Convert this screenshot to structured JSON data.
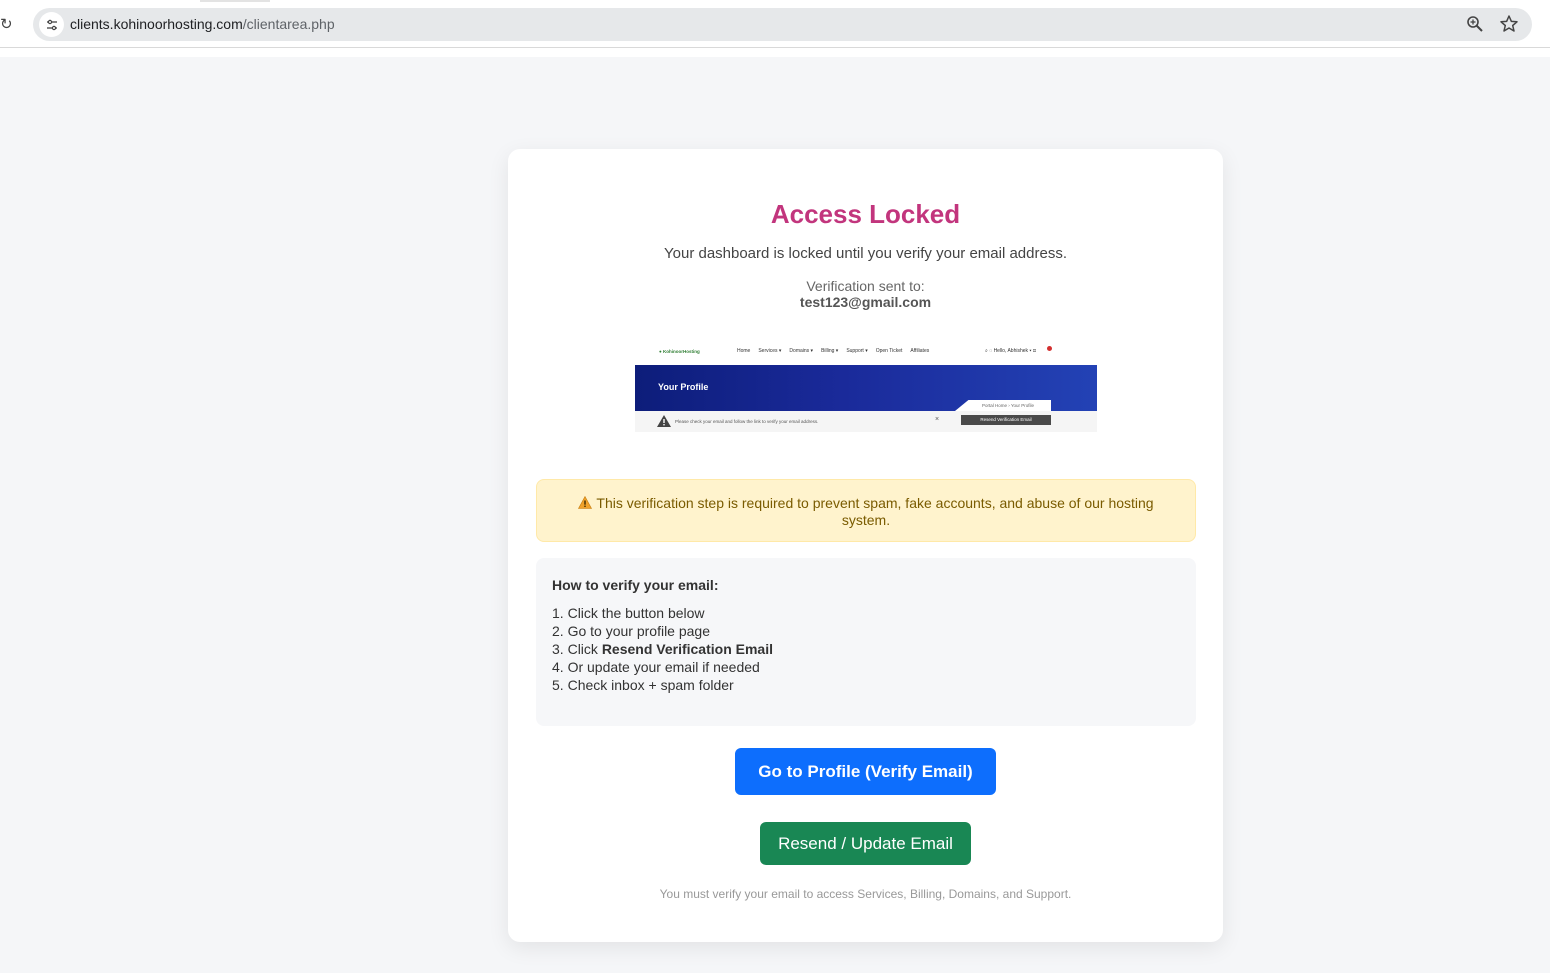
{
  "browser": {
    "url_domain": "clients.kohinoorhosting.com",
    "url_path": "/clientarea.php"
  },
  "card": {
    "title": "Access Locked",
    "subtitle": "Your dashboard is locked until you verify your email address.",
    "sent_label": "Verification sent to:",
    "sent_email": "test123@gmail.com"
  },
  "preview": {
    "logo": "KohinoorHosting",
    "nav_links": [
      "Home",
      "Services ▾",
      "Domains ▾",
      "Billing ▾",
      "Support ▾",
      "Open Ticket",
      "Affiliates"
    ],
    "user": "Hello, Abhishek ▾",
    "banner_title": "Your Profile",
    "breadcrumb": "Portal Home  ›  Your Profile",
    "alert_text": "Please check your email and follow the link to verify your email address.",
    "alert_close": "×",
    "resend_button": "Resend Verification Email"
  },
  "warning": {
    "text": "This verification step is required to prevent spam, fake accounts, and abuse of our hosting system."
  },
  "steps": {
    "title": "How to verify your email:",
    "items": [
      {
        "num": "1.",
        "pre": "Click the button below",
        "bold": "",
        "post": ""
      },
      {
        "num": "2.",
        "pre": "Go to your profile page",
        "bold": "",
        "post": ""
      },
      {
        "num": "3.",
        "pre": "Click ",
        "bold": "Resend Verification Email",
        "post": ""
      },
      {
        "num": "4.",
        "pre": "Or update your email if needed",
        "bold": "",
        "post": ""
      },
      {
        "num": "5.",
        "pre": "Check inbox + spam folder",
        "bold": "",
        "post": ""
      }
    ]
  },
  "buttons": {
    "primary": "Go to Profile (Verify Email)",
    "secondary": "Resend / Update Email"
  },
  "footer_note": "You must verify your email to access Services, Billing, Domains, and Support.",
  "colors": {
    "title": "#c2357d",
    "primary": "#0d6efd",
    "success": "#198754",
    "warning_bg": "#fff3cd"
  }
}
